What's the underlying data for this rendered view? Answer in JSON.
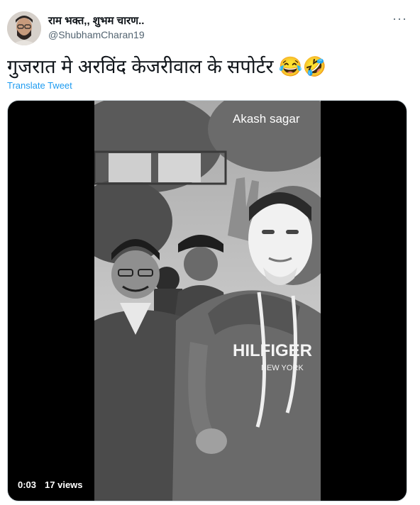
{
  "author": {
    "name": "राम भक्त,, शुभम चारण..",
    "handle": "@ShubhamCharan19"
  },
  "tweet": {
    "text": "गुजरात मे अरविंद केजरीवाल के सपोर्टर 😂🤣",
    "translate_label": "Translate Tweet"
  },
  "media": {
    "watermark": "Akash sagar",
    "sweater_text": "HILFIGER",
    "sweater_subtext": "NEW YORK",
    "time": "0:03",
    "views": "17 views"
  },
  "icons": {
    "more": "more-dots-icon"
  }
}
